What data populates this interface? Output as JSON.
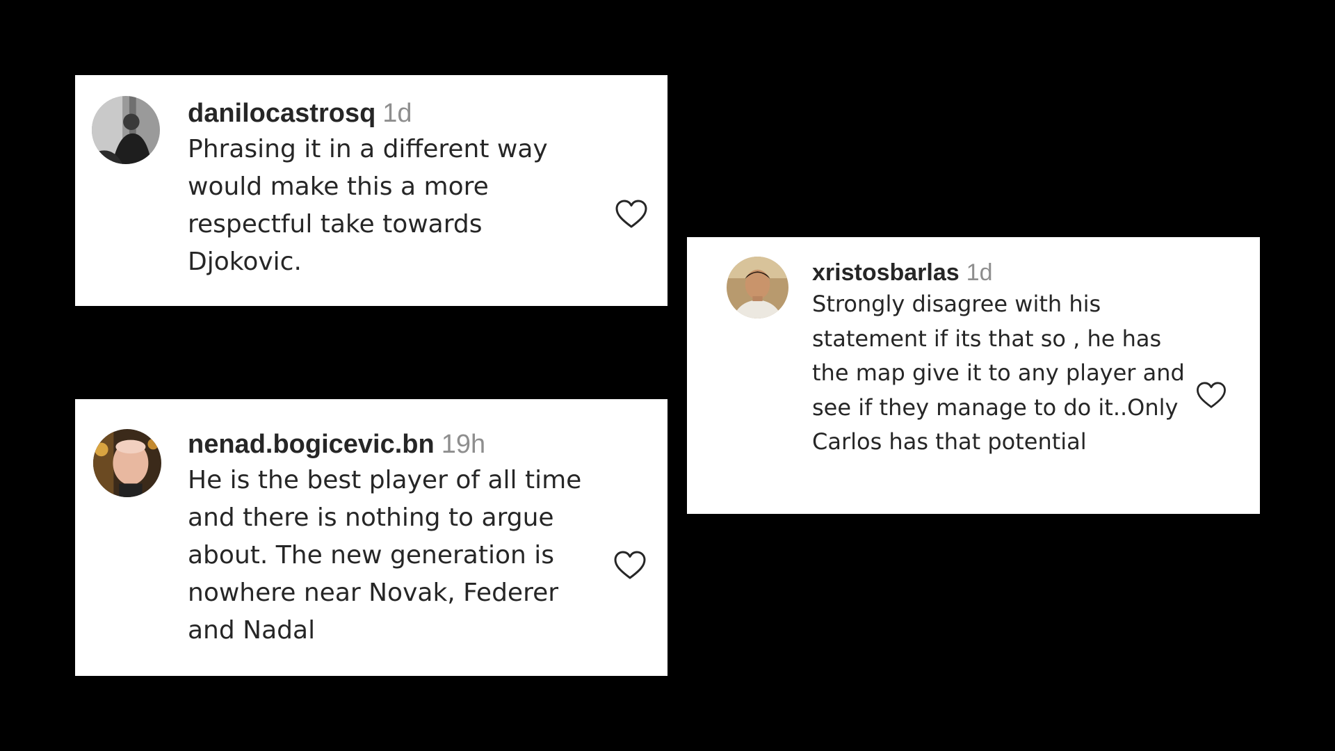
{
  "comments": [
    {
      "username": "danilocastrosq",
      "timestamp": "1d",
      "text": "Phrasing it in a different way would make this a more respectful take towards Djokovic.",
      "like_icon": "heart-outline-icon"
    },
    {
      "username": "nenad.bogicevic.bn",
      "timestamp": "19h",
      "text": "He is the best player of all time and there is nothing to argue about. The new generation is nowhere near Novak, Federer and Nadal",
      "like_icon": "heart-outline-icon"
    },
    {
      "username": "xristosbarlas",
      "timestamp": "1d",
      "text": "Strongly disagree with his statement if its that so , he has the map give it to any player and see if they manage to do it..Only Carlos has that potential",
      "like_icon": "heart-outline-icon"
    }
  ],
  "colors": {
    "background": "#000000",
    "card": "#ffffff",
    "text_primary": "#262626",
    "text_secondary": "#8e8e8e"
  }
}
